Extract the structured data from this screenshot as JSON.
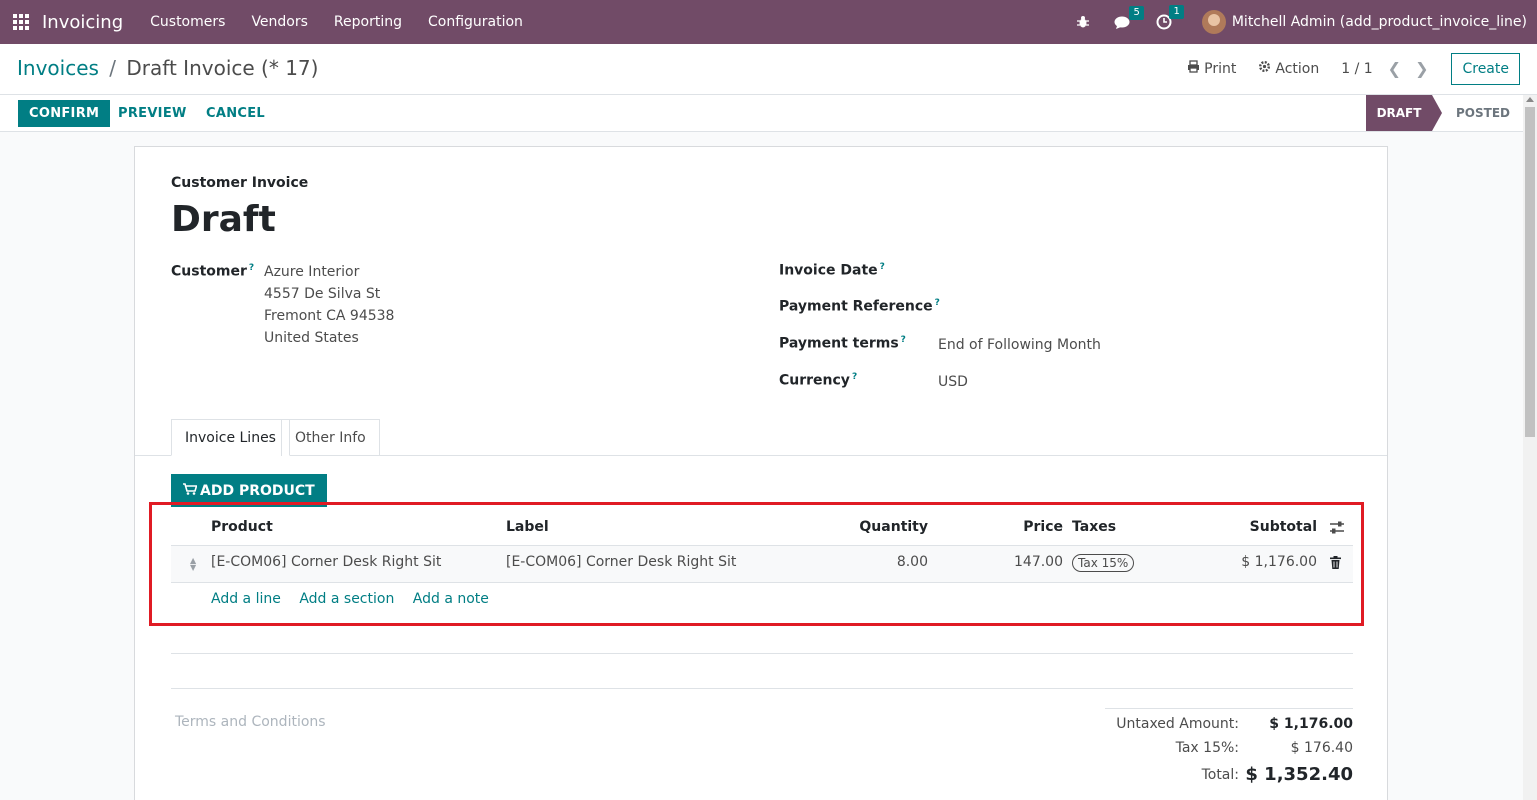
{
  "navbar": {
    "app_name": "Invoicing",
    "menu": [
      "Customers",
      "Vendors",
      "Reporting",
      "Configuration"
    ],
    "chat_count": "5",
    "activity_count": "1",
    "user": "Mitchell Admin (add_product_invoice_line)"
  },
  "breadcrumb": {
    "parent": "Invoices",
    "separator": "/",
    "current": "Draft Invoice (* 17)"
  },
  "control": {
    "print": "Print",
    "action": "Action",
    "pager": "1 / 1",
    "create": "Create"
  },
  "status": {
    "confirm": "CONFIRM",
    "preview": "PREVIEW",
    "cancel": "CANCEL",
    "stages": [
      "DRAFT",
      "POSTED"
    ]
  },
  "form": {
    "type": "Customer Invoice",
    "title": "Draft",
    "customer_label": "Customer",
    "customer_address": [
      "Azure Interior",
      "4557 De Silva St",
      "Fremont CA 94538",
      "United States"
    ],
    "invoice_date_label": "Invoice Date",
    "payment_reference_label": "Payment Reference",
    "payment_terms_label": "Payment terms",
    "payment_terms_value": "End of Following Month",
    "currency_label": "Currency",
    "currency_value": "USD",
    "help_mark": "?"
  },
  "tabs": [
    "Invoice Lines",
    "Other Info"
  ],
  "lines": {
    "add_product": "ADD PRODUCT",
    "columns": [
      "Product",
      "Label",
      "Quantity",
      "Price",
      "Taxes",
      "Subtotal"
    ],
    "rows": [
      {
        "product": "[E-COM06] Corner Desk Right Sit",
        "label": "[E-COM06] Corner Desk Right Sit",
        "quantity": "8.00",
        "price": "147.00",
        "tax": "Tax 15%",
        "subtotal": "$ 1,176.00"
      }
    ],
    "add_line": "Add a line",
    "add_section": "Add a section",
    "add_note": "Add a note"
  },
  "footer": {
    "terms_placeholder": "Terms and Conditions",
    "untaxed_label": "Untaxed Amount:",
    "untaxed_value": "$ 1,176.00",
    "tax_label": "Tax 15%:",
    "tax_value": "$ 176.40",
    "total_label": "Total:",
    "total_value": "$ 1,352.40"
  },
  "colors": {
    "brand": "#714b67",
    "accent": "#017e84",
    "highlight": "#e01b24"
  }
}
